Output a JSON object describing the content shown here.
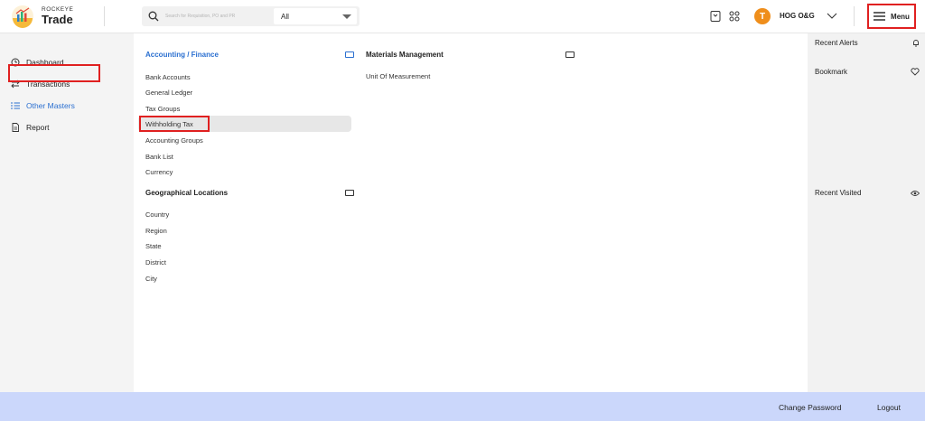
{
  "app": {
    "brand_top": "ROCKEYE",
    "brand_bottom": "Trade"
  },
  "search": {
    "placeholder": "Search for Requisition, PO and PR",
    "scope_value": "All"
  },
  "header": {
    "avatar_letter": "T",
    "org_name": "HOG O&G",
    "menu_label": "Menu"
  },
  "sidebar": {
    "items": [
      {
        "label": "Dashboard",
        "icon": "gauge-icon"
      },
      {
        "label": "Transactions",
        "icon": "swap-icon"
      },
      {
        "label": "Other Masters",
        "icon": "list-icon"
      },
      {
        "label": "Report",
        "icon": "document-icon"
      }
    ]
  },
  "main": {
    "accounting": {
      "title": "Accounting / Finance",
      "items": [
        "Bank Accounts",
        "General Ledger",
        "Tax Groups",
        "Withholding Tax",
        "Accounting Groups",
        "Bank List",
        "Currency"
      ]
    },
    "geo": {
      "title": "Geographical Locations",
      "items": [
        "Country",
        "Region",
        "State",
        "District",
        "City"
      ]
    },
    "materials": {
      "title": "Materials Management",
      "items": [
        "Unit Of Measurement"
      ]
    }
  },
  "right_panel": {
    "recent_alerts": "Recent Alerts",
    "bookmark": "Bookmark",
    "recent_visited": "Recent Visited"
  },
  "footer": {
    "change_password": "Change Password",
    "logout": "Logout"
  },
  "colors": {
    "accent": "#2a6fd0",
    "avatar": "#ef8e1b",
    "highlight_border": "#e02020",
    "footer_bg": "#cbd7fb"
  }
}
